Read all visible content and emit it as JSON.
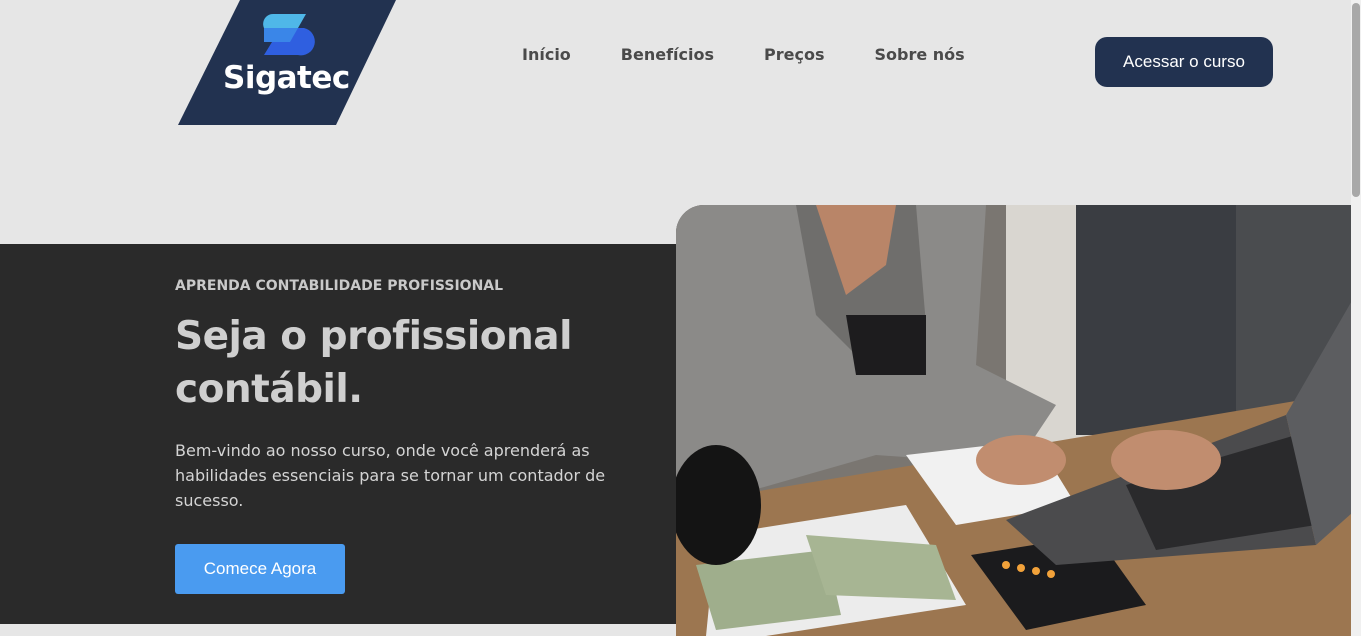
{
  "brand": {
    "name": "Sigatec",
    "colors": {
      "navy": "#223250",
      "blue_light": "#4fb7e8",
      "blue_dark": "#2f5fe0"
    }
  },
  "nav": {
    "items": [
      {
        "label": "Início"
      },
      {
        "label": "Benefícios"
      },
      {
        "label": "Preços"
      },
      {
        "label": "Sobre nós"
      }
    ],
    "cta_label": "Acessar o curso"
  },
  "hero": {
    "eyebrow": "APRENDA CONTABILIDADE PROFISSIONAL",
    "headline": "Seja o profissional contábil.",
    "description": "Bem-vindo ao nosso curso, onde você aprenderá as habilidades essenciais para se tornar um contador de sucesso.",
    "cta_label": "Comece Agora",
    "colors": {
      "panel": "#2a2a2a",
      "cta": "#4a9bf0"
    }
  }
}
